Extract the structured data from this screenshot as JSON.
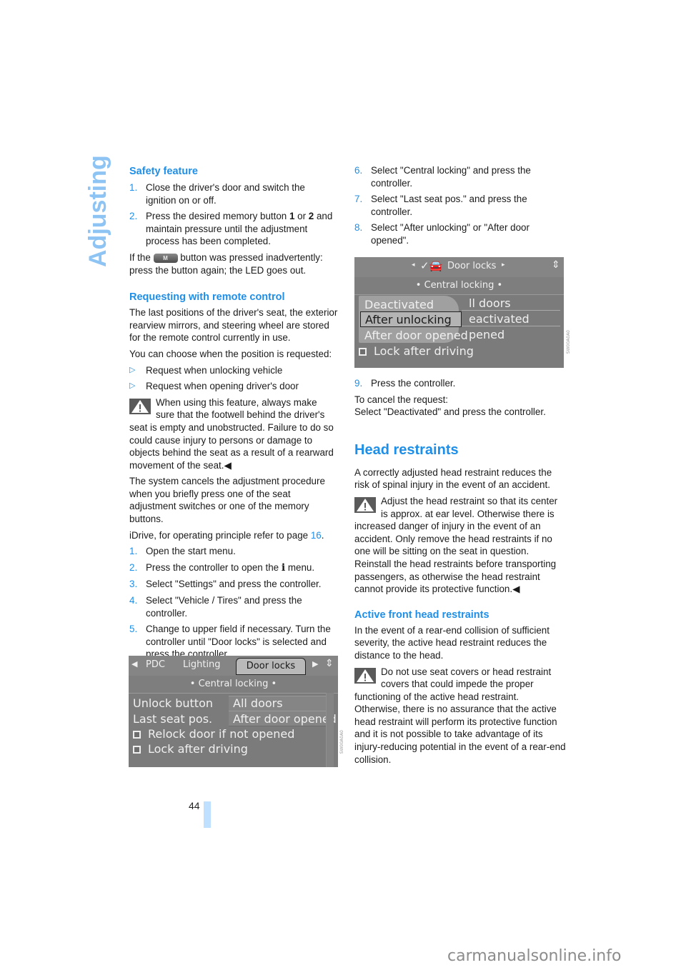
{
  "side_title": "Adjusting",
  "page_number": "44",
  "watermark": "carmanualsonline.info",
  "left": {
    "safety_feature": {
      "heading": "Safety feature",
      "steps": [
        {
          "num": "1.",
          "text": "Close the driver's door and switch the ignition on or off."
        },
        {
          "num": "2.",
          "text_before": "Press the desired memory button ",
          "bold1": "1",
          "mid": " or ",
          "bold2": "2",
          "text_after": " and maintain pressure until the adjustment process has been completed."
        }
      ],
      "note_before": "If the ",
      "button_label": "M",
      "note_after": " button was pressed inadvertently: press the button again; the LED goes out."
    },
    "remote": {
      "heading": "Requesting with remote control",
      "intro": "The last positions of the driver's seat, the exterior rearview mirrors, and steering wheel are stored for the remote control currently in use.",
      "choose": "You can choose when the position is requested:",
      "bullet_symbol": "▷",
      "bullets": [
        "Request when unlocking vehicle",
        "Request when opening driver's door"
      ],
      "warning": "When using this feature, always make sure that the footwell behind the driver's seat is empty and unobstructed. Failure to do so could cause injury to persons or damage to objects behind the seat as a result of a rearward movement of the seat.",
      "end_mark": "◀",
      "cancel_text": "The system cancels the adjustment procedure when you briefly press one of the seat adjustment switches or one of the memory buttons.",
      "idrive_before": "iDrive, for operating principle refer to page ",
      "idrive_page": "16",
      "idrive_after": ".",
      "steps": [
        {
          "num": "1.",
          "text": "Open the start menu."
        },
        {
          "num": "2.",
          "text_before": "Press the controller to open the ",
          "icon": "i",
          "text_after": " menu."
        },
        {
          "num": "3.",
          "text": "Select \"Settings\" and press the controller."
        },
        {
          "num": "4.",
          "text": "Select \"Vehicle / Tires\" and press the controller."
        },
        {
          "num": "5.",
          "text": "Change to upper field if necessary. Turn the controller until \"Door locks\" is selected and press the controller."
        }
      ]
    },
    "screen": {
      "tabs": [
        "PDC",
        "Lighting",
        "Door locks"
      ],
      "selected_tab": "Door locks",
      "sub_title": "• Central locking •",
      "rows": [
        {
          "label": "Unlock button",
          "value": "All doors"
        },
        {
          "label": "Last seat pos.",
          "value": "After door opened"
        }
      ],
      "checkboxes": [
        "Relock door if not opened",
        "Lock after driving"
      ],
      "code": "SW00A0A0"
    }
  },
  "right": {
    "steps": [
      {
        "num": "6.",
        "text": "Select \"Central locking\" and press the controller."
      },
      {
        "num": "7.",
        "text": "Select \"Last seat pos.\" and press the controller."
      },
      {
        "num": "8.",
        "text": "Select \"After unlocking\" or \"After door opened\"."
      }
    ],
    "screen": {
      "title": "Door locks",
      "sub_title": "• Central locking •",
      "popup_options": [
        "Deactivated",
        "After unlocking",
        "After door opened"
      ],
      "selected_option": "After unlocking",
      "behind_values": [
        "ll doors",
        "eactivated",
        "pened"
      ],
      "checkbox": "Lock after driving",
      "code": "SW00A0A0"
    },
    "step9": {
      "num": "9.",
      "text": "Press the controller."
    },
    "cancel": "To cancel the request:",
    "cancel2": "Select \"Deactivated\" and press the controller.",
    "head_restraints": {
      "heading": "Head restraints",
      "intro": "A correctly adjusted head restraint reduces the risk of spinal injury in the event of an accident.",
      "warning": "Adjust the head restraint so that its center is approx. at ear level. Otherwise there is increased danger of injury in the event of an accident. Only remove the head restraints if no one will be sitting on the seat in question. Reinstall the head restraints before transporting passengers, as otherwise the head restraint cannot provide its protective function.",
      "end_mark": "◀"
    },
    "active": {
      "heading": "Active front head restraints",
      "intro": "In the event of a rear-end collision of sufficient severity, the active head restraint reduces the distance to the head.",
      "warning": "Do not use seat covers or head restraint covers that could impede the proper functioning of the active head restraint. Otherwise, there is no assurance that the active head restraint will perform its protective function and it is not possible to take advantage of its injury-reducing potential in the event of a rear-end collision."
    }
  }
}
